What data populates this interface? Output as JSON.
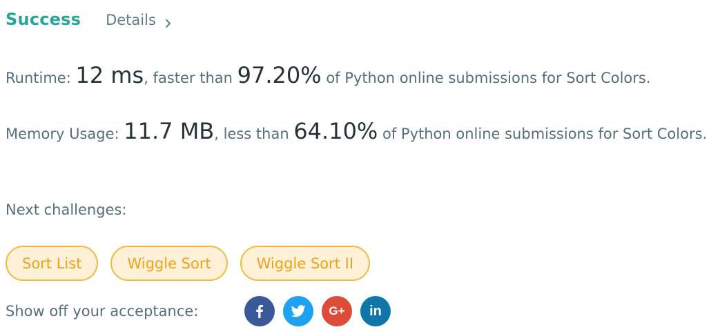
{
  "header": {
    "status": "Success",
    "details_label": "Details"
  },
  "runtime": {
    "label": "Runtime: ",
    "value": "12 ms",
    "comparator": ", faster than ",
    "percent": "97.20%",
    "suffix": " of Python online submissions for Sort Colors."
  },
  "memory": {
    "label": "Memory Usage: ",
    "value": "11.7 MB",
    "comparator": ", less than ",
    "percent": "64.10%",
    "suffix": " of Python online submissions for Sort Colors."
  },
  "next": {
    "label": "Next challenges:",
    "items": [
      "Sort List",
      "Wiggle Sort",
      "Wiggle Sort II"
    ]
  },
  "share": {
    "label": "Show off your acceptance:",
    "networks": [
      {
        "name": "facebook",
        "icon": "facebook-icon",
        "glyph": "f",
        "color": "#3b5998"
      },
      {
        "name": "twitter",
        "icon": "twitter-icon",
        "glyph": "",
        "color": "#1da1f2"
      },
      {
        "name": "google-plus",
        "icon": "google-plus-icon",
        "glyph": "G+",
        "color": "#dd4b39"
      },
      {
        "name": "linkedin",
        "icon": "linkedin-icon",
        "glyph": "in",
        "color": "#0e76a8"
      }
    ]
  },
  "colors": {
    "success": "#26a69a",
    "tag_border": "#f5b942",
    "tag_bg": "#fff0d8",
    "tag_text": "#f0a21a"
  }
}
